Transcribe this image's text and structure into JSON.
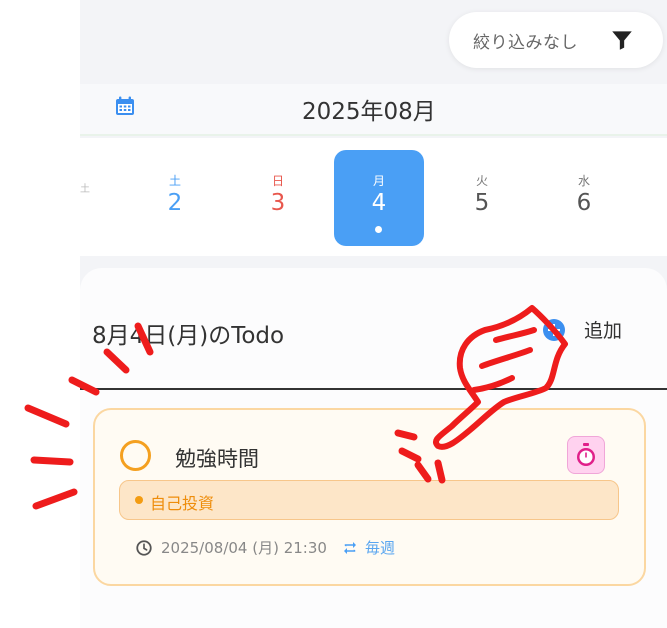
{
  "filter": {
    "label": "絞り込みなし",
    "icon": "filter-icon"
  },
  "calendar": {
    "icon": "calendar-icon",
    "month_title": "2025年08月",
    "days": [
      {
        "dow": "土",
        "num": "2",
        "color": "#4a9ff5"
      },
      {
        "dow": "日",
        "num": "3",
        "color": "#e8574d"
      },
      {
        "dow": "月",
        "num": "4",
        "color": "#ffffff",
        "selected": true
      },
      {
        "dow": "火",
        "num": "5",
        "color": "#555555"
      },
      {
        "dow": "水",
        "num": "6",
        "color": "#555555"
      }
    ],
    "edge_mark": "土"
  },
  "todo": {
    "title": "8月4日(月)のTodo",
    "add_label": "追加",
    "add_icon": "plus-circle-icon"
  },
  "task": {
    "title": "勉強時間",
    "category": "自己投資",
    "datetime": "2025/08/04 (月) 21:30",
    "repeat": "毎週",
    "timer_icon": "stopwatch-icon",
    "clock_icon": "clock-icon",
    "repeat_icon": "repeat-icon"
  },
  "colors": {
    "accent": "#4a9ff5",
    "sunday": "#e8574d",
    "saturday": "#4a9ff5",
    "category_orange": "#f39c12",
    "annotation_red": "#ee1c1c"
  }
}
